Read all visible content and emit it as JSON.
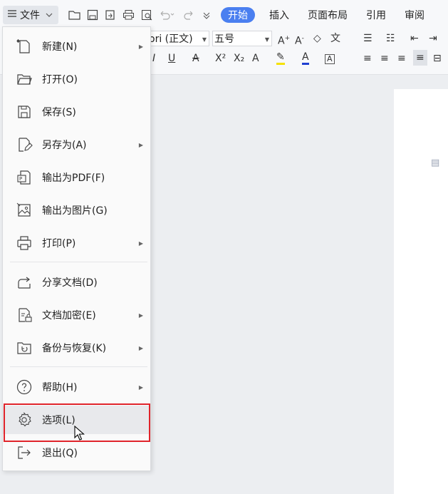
{
  "toolbar": {
    "file_menu_label": "文件",
    "tabs": [
      "开始",
      "插入",
      "页面布局",
      "引用",
      "审阅"
    ],
    "font_name": "ori (正文)",
    "font_size": "五号"
  },
  "menu": {
    "items": [
      {
        "label": "新建(N)",
        "has_submenu": true,
        "icon": "new-document-icon"
      },
      {
        "label": "打开(O)",
        "has_submenu": false,
        "icon": "folder-open-icon"
      },
      {
        "label": "保存(S)",
        "has_submenu": false,
        "icon": "save-icon"
      },
      {
        "label": "另存为(A)",
        "has_submenu": true,
        "icon": "save-as-icon"
      },
      {
        "label": "输出为PDF(F)",
        "has_submenu": false,
        "icon": "export-pdf-icon"
      },
      {
        "label": "输出为图片(G)",
        "has_submenu": false,
        "icon": "export-image-icon"
      },
      {
        "label": "打印(P)",
        "has_submenu": true,
        "icon": "printer-icon"
      },
      {
        "label": "分享文档(D)",
        "has_submenu": false,
        "icon": "share-icon"
      },
      {
        "label": "文档加密(E)",
        "has_submenu": true,
        "icon": "encrypt-document-icon"
      },
      {
        "label": "备份与恢复(K)",
        "has_submenu": true,
        "icon": "backup-restore-icon"
      },
      {
        "label": "帮助(H)",
        "has_submenu": true,
        "icon": "help-icon"
      },
      {
        "label": "选项(L)",
        "has_submenu": false,
        "icon": "gear-icon",
        "highlighted": true
      },
      {
        "label": "退出(Q)",
        "has_submenu": false,
        "icon": "exit-icon"
      }
    ]
  },
  "colors": {
    "active_tab": "#4a7ff0",
    "highlight_border": "#e0242b"
  }
}
